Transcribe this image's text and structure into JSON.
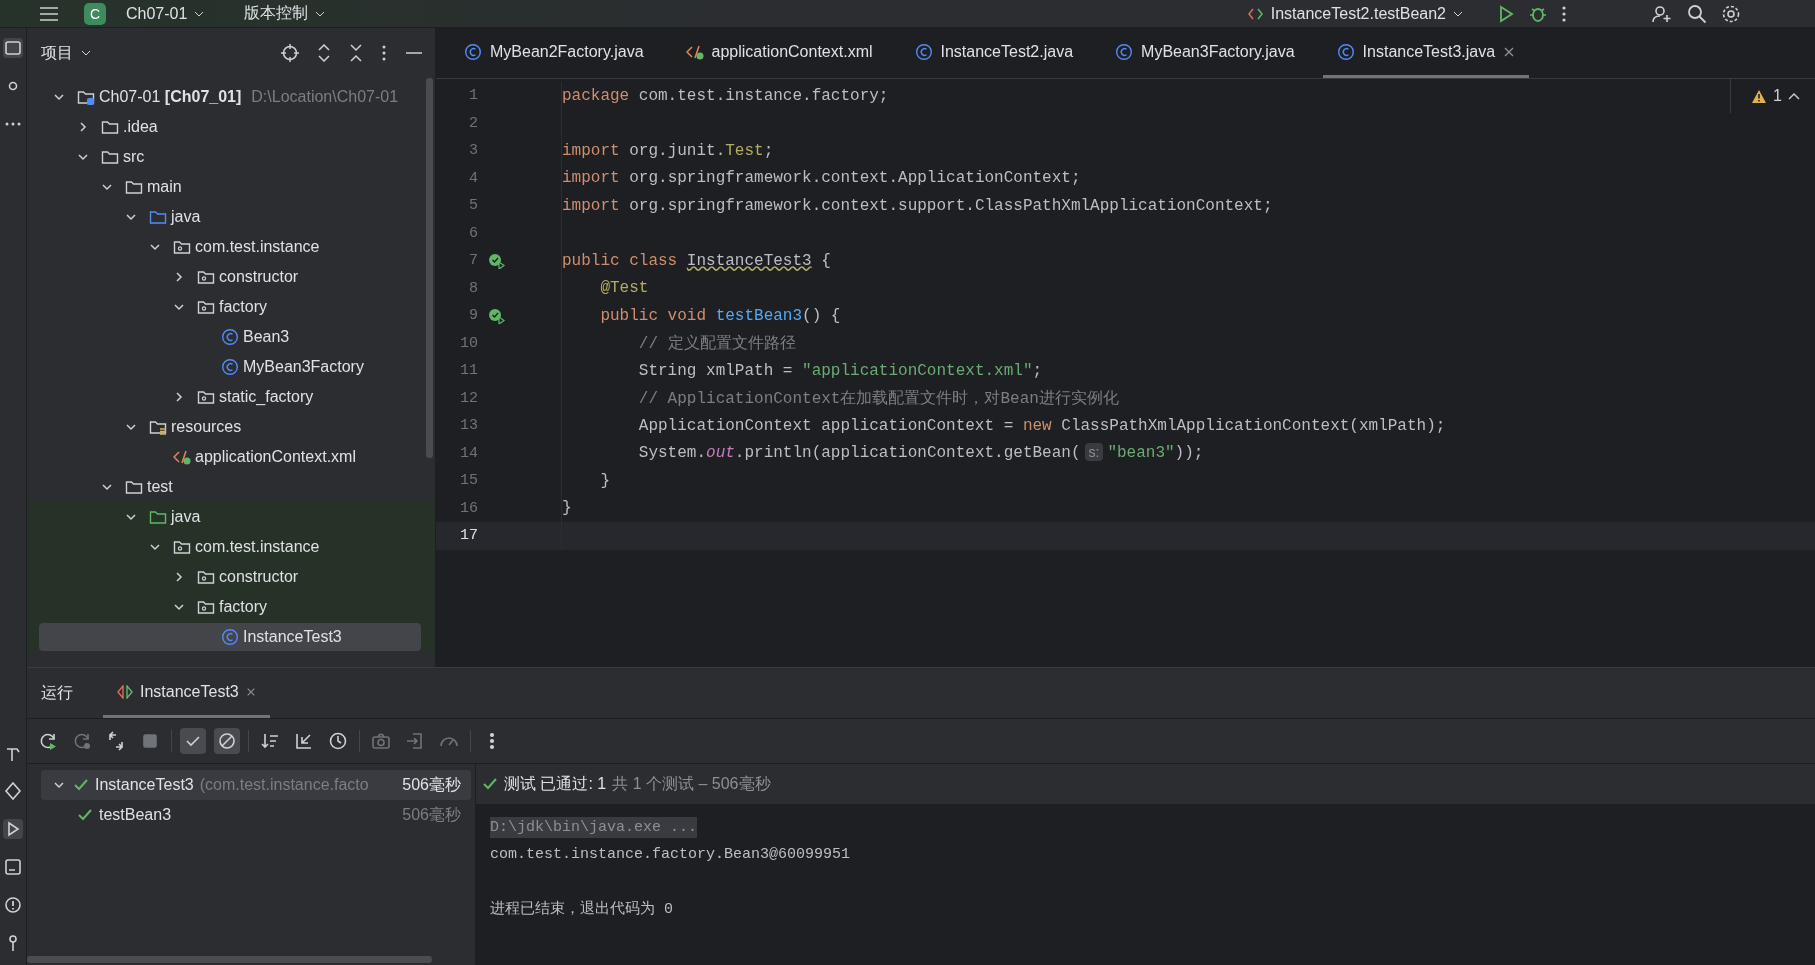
{
  "top_bar": {
    "project_badge": "C",
    "project": "Ch07-01",
    "vcs": "版本控制",
    "run_config": "InstanceTest2.testBean2"
  },
  "project": {
    "title": "项目",
    "tree": [
      {
        "label": "Ch07-01 **[Ch07_01]**",
        "path": "D:\\Location\\Ch07-01",
        "kind": "project",
        "expanded": true,
        "selected": false,
        "children": [
          {
            "label": ".idea",
            "kind": "folder",
            "expanded": false,
            "selected": false
          },
          {
            "label": "src",
            "kind": "folder",
            "expanded": true,
            "selected": false,
            "children": [
              {
                "label": "main",
                "kind": "folder",
                "expanded": true,
                "selected": false,
                "children": [
                  {
                    "label": "java",
                    "kind": "source",
                    "expanded": true,
                    "selected": false,
                    "children": [
                      {
                        "label": "com.test.instance",
                        "kind": "package",
                        "expanded": true,
                        "selected": false,
                        "children": [
                          {
                            "label": "constructor",
                            "kind": "package",
                            "expanded": false,
                            "selected": false
                          },
                          {
                            "label": "factory",
                            "kind": "package",
                            "expanded": true,
                            "selected": false,
                            "children": [
                              {
                                "label": "Bean3",
                                "kind": "class",
                                "selected": false
                              },
                              {
                                "label": "MyBean3Factory",
                                "kind": "class",
                                "selected": false
                              }
                            ]
                          },
                          {
                            "label": "static_factory",
                            "kind": "package",
                            "expanded": false,
                            "selected": false
                          }
                        ]
                      }
                    ]
                  },
                  {
                    "label": "resources",
                    "kind": "resources",
                    "expanded": true,
                    "selected": false,
                    "children": [
                      {
                        "label": "applicationContext.xml",
                        "kind": "xml",
                        "selected": false
                      }
                    ]
                  }
                ]
              },
              {
                "label": "test",
                "kind": "folder",
                "expanded": true,
                "selected": false,
                "children": [
                  {
                    "label": "java",
                    "kind": "tests",
                    "expanded": true,
                    "selected": false,
                    "children": [
                      {
                        "label": "com.test.instance",
                        "kind": "package",
                        "expanded": true,
                        "selected": false,
                        "children": [
                          {
                            "label": "constructor",
                            "kind": "package",
                            "expanded": false,
                            "selected": false
                          },
                          {
                            "label": "factory",
                            "kind": "package",
                            "expanded": true,
                            "selected": false,
                            "children": [
                              {
                                "label": "InstanceTest3",
                                "kind": "class",
                                "selected": true
                              }
                            ]
                          }
                        ]
                      }
                    ]
                  }
                ]
              }
            ]
          }
        ]
      }
    ]
  },
  "editor": {
    "tabs": [
      {
        "label": "MyBean2Factory.java",
        "kind": "class",
        "selected": false
      },
      {
        "label": "applicationContext.xml",
        "kind": "xml",
        "selected": false
      },
      {
        "label": "InstanceTest2.java",
        "kind": "class",
        "selected": false
      },
      {
        "label": "MyBean3Factory.java",
        "kind": "class",
        "selected": false
      },
      {
        "label": "InstanceTest3.java",
        "kind": "class",
        "selected": true
      }
    ],
    "warnings": "1",
    "lines": [
      {
        "n": "1",
        "run": false,
        "current": false,
        "tokens": [
          {
            "kind": "kw",
            "t": "package "
          },
          {
            "kind": "plain",
            "t": "com.test.instance.factory;"
          }
        ]
      },
      {
        "n": "2",
        "run": false,
        "current": false
      },
      {
        "n": "3",
        "run": false,
        "current": false,
        "tokens": [
          {
            "kind": "kw",
            "t": "import "
          },
          {
            "kind": "plain",
            "t": "org.junit."
          },
          {
            "kind": "ann",
            "t": "Test"
          },
          {
            "kind": "plain",
            "t": ";"
          }
        ]
      },
      {
        "n": "4",
        "run": false,
        "current": false,
        "tokens": [
          {
            "kind": "kw",
            "t": "import "
          },
          {
            "kind": "plain",
            "t": "org.springframework.context.ApplicationContext;"
          }
        ]
      },
      {
        "n": "5",
        "run": false,
        "current": false,
        "tokens": [
          {
            "kind": "kw",
            "t": "import "
          },
          {
            "kind": "plain",
            "t": "org.springframework.context.support.ClassPathXmlApplicationContext;"
          }
        ]
      },
      {
        "n": "6",
        "run": false,
        "current": false
      },
      {
        "n": "7",
        "run": true,
        "current": false,
        "tokens": [
          {
            "kind": "kw",
            "t": "public class "
          },
          {
            "kind": "warn",
            "t": "InstanceTest3"
          },
          {
            "kind": "plain",
            "t": " {"
          }
        ]
      },
      {
        "n": "8",
        "run": false,
        "current": false,
        "tokens": [
          {
            "kind": "ann",
            "t": "    @Test"
          }
        ]
      },
      {
        "n": "9",
        "run": true,
        "current": false,
        "tokens": [
          {
            "kind": "kw",
            "t": "    public void "
          },
          {
            "kind": "fn",
            "t": "testBean3"
          },
          {
            "kind": "plain",
            "t": "() {"
          }
        ]
      },
      {
        "n": "10",
        "run": false,
        "current": false,
        "tokens": [
          {
            "kind": "comment",
            "t": "        // 定义配置文件路径"
          }
        ]
      },
      {
        "n": "11",
        "run": false,
        "current": false,
        "tokens": [
          {
            "kind": "plain",
            "t": "        String xmlPath = "
          },
          {
            "kind": "str",
            "t": "\"applicationContext.xml\""
          },
          {
            "kind": "plain",
            "t": ";"
          }
        ]
      },
      {
        "n": "12",
        "run": false,
        "current": false,
        "tokens": [
          {
            "kind": "comment",
            "t": "        // ApplicationContext在加载配置文件时，对Bean进行实例化"
          }
        ]
      },
      {
        "n": "13",
        "run": false,
        "current": false,
        "tokens": [
          {
            "kind": "plain",
            "t": "        ApplicationContext applicationContext = "
          },
          {
            "kind": "kw",
            "t": "new "
          },
          {
            "kind": "plain",
            "t": "ClassPathXmlApplicationContext(xmlPath);"
          }
        ]
      },
      {
        "n": "14",
        "run": false,
        "current": false,
        "tokens": [
          {
            "kind": "plain",
            "t": "        System."
          },
          {
            "kind": "static",
            "t": "out"
          },
          {
            "kind": "plain",
            "t": ".println(applicationContext.getBean("
          },
          {
            "kind": "hint",
            "t": "s:"
          },
          {
            "kind": "str",
            "t": "\"bean3\""
          },
          {
            "kind": "plain",
            "t": "));"
          }
        ]
      },
      {
        "n": "15",
        "run": false,
        "current": false,
        "tokens": [
          {
            "kind": "plain",
            "t": "    }"
          }
        ]
      },
      {
        "n": "16",
        "run": false,
        "current": false,
        "tokens": [
          {
            "kind": "plain",
            "t": "}"
          }
        ]
      },
      {
        "n": "17",
        "run": false,
        "current": true
      }
    ]
  },
  "run_panel": {
    "title": "运行",
    "tabs": [
      {
        "label": "InstanceTest3",
        "selected": true
      }
    ],
    "toolbar": [
      {
        "kind": "rerun",
        "on": false,
        "disabled": false
      },
      {
        "kind": "rerun-failed",
        "on": false,
        "disabled": true
      },
      {
        "kind": "toggle-auto",
        "on": false,
        "disabled": false
      },
      {
        "kind": "stop",
        "on": false,
        "disabled": true
      },
      {
        "kind": "show-passed",
        "on": true,
        "disabled": false
      },
      {
        "kind": "show-ignored",
        "on": true,
        "disabled": false
      },
      {
        "kind": "sort",
        "on": false,
        "disabled": false
      },
      {
        "kind": "collapse",
        "on": false,
        "disabled": false
      },
      {
        "kind": "history",
        "on": false,
        "disabled": false
      },
      {
        "kind": "camera",
        "on": false,
        "disabled": true
      },
      {
        "kind": "import",
        "on": false,
        "disabled": true
      },
      {
        "kind": "gauge",
        "on": false,
        "disabled": true
      },
      {
        "kind": "more",
        "on": false,
        "disabled": false
      }
    ],
    "results": [
      {
        "name": "InstanceTest3",
        "detail": "(com.test.instance.facto",
        "time": "506毫秒",
        "passed": true,
        "selected": true,
        "children": [
          {
            "name": "testBean3",
            "time": "506毫秒",
            "passed": true,
            "selected": false
          }
        ]
      }
    ],
    "status": {
      "passed": "测试 已通过: 1",
      "summary": "共 1 个测试 – 506毫秒"
    },
    "console": [
      {
        "kind": "command",
        "text": "D:\\jdk\\bin\\java.exe ..."
      },
      {
        "kind": "out",
        "text": "com.test.instance.factory.Bean3@60099951"
      },
      {
        "kind": "exit",
        "text": "进程已结束，退出代码为 0"
      }
    ]
  }
}
